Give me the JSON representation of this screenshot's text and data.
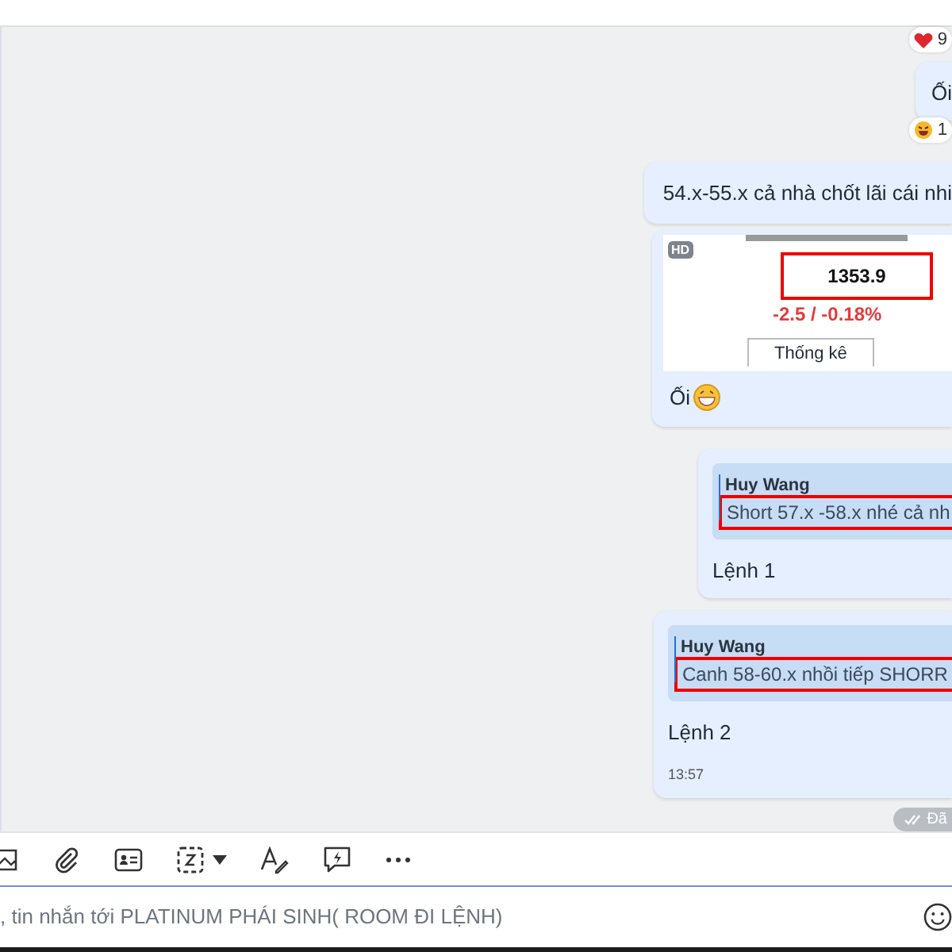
{
  "messages": [
    {
      "kind": "text",
      "text": "Ối",
      "reaction": {
        "kind": "laugh",
        "count": "1"
      },
      "top_reaction": {
        "kind": "heart",
        "count": "9"
      }
    },
    {
      "kind": "text",
      "text": "54.x-55.x cả nhà chốt lãi cái nhi"
    },
    {
      "kind": "image",
      "badge": "HD",
      "price": "1353.9",
      "price_highlighted": true,
      "change": "-2.5 / -0.18%",
      "tab": "Thống kê",
      "caption": "Ối"
    },
    {
      "kind": "reply",
      "quote_author": "Huy Wang",
      "quote_text": "Short 57.x -58.x nhé cả nh",
      "quote_highlighted": true,
      "text": "Lệnh 1"
    },
    {
      "kind": "reply",
      "quote_author": "Huy Wang",
      "quote_text": "Canh 58-60.x nhồi tiếp SHORR",
      "quote_highlighted": true,
      "text": "Lệnh 2",
      "time": "13:57"
    }
  ],
  "status": "Đã",
  "composer": {
    "placeholder": ", tin nhắn tới PLATINUM PHÁI SINH( ROOM ĐI LỆNH)"
  }
}
